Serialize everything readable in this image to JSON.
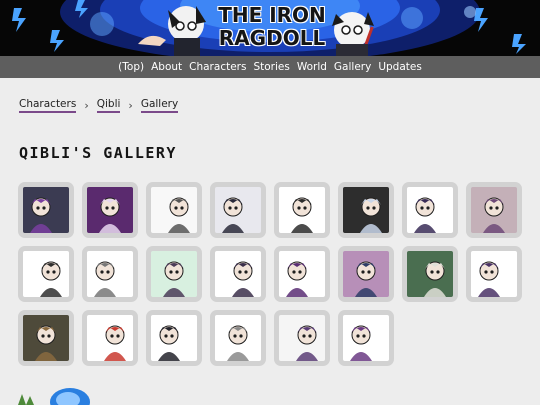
{
  "site": {
    "title_line1": "THE IRON",
    "title_line2": "RAGDOLL"
  },
  "nav": {
    "items": [
      "(Top)",
      "About",
      "Characters",
      "Stories",
      "World",
      "Gallery",
      "Updates"
    ]
  },
  "breadcrumb": {
    "items": [
      "Characters",
      "Qibli",
      "Gallery"
    ]
  },
  "page": {
    "title": "QIBLI'S GALLERY"
  },
  "gallery": {
    "thumbnails": [
      {
        "bg": "#3b3b52",
        "accent": "#7a3fa0"
      },
      {
        "bg": "#5a2a6e",
        "accent": "#e7d7f0"
      },
      {
        "bg": "#f8f8f8",
        "accent": "#555555"
      },
      {
        "bg": "#e8e8ee",
        "accent": "#2a2a3a"
      },
      {
        "bg": "#ffffff",
        "accent": "#2b2b2b"
      },
      {
        "bg": "#2d2d2d",
        "accent": "#c9d6ea"
      },
      {
        "bg": "#ffffff",
        "accent": "#3a2d57"
      },
      {
        "bg": "#c4b0b8",
        "accent": "#6e4a78"
      },
      {
        "bg": "#ffffff",
        "accent": "#2e2e2e"
      },
      {
        "bg": "#ffffff",
        "accent": "#777777"
      },
      {
        "bg": "#d8f0e0",
        "accent": "#4b3b57"
      },
      {
        "bg": "#ffffff",
        "accent": "#3b2f4a"
      },
      {
        "bg": "#ffffff",
        "accent": "#5a2e74"
      },
      {
        "bg": "#b78fb8",
        "accent": "#2e3d66"
      },
      {
        "bg": "#4a6e50",
        "accent": "#e0e0d8"
      },
      {
        "bg": "#ffffff",
        "accent": "#4a3366"
      },
      {
        "bg": "#4e4a3a",
        "accent": "#8a6a3f"
      },
      {
        "bg": "#ffffff",
        "accent": "#c93a2f"
      },
      {
        "bg": "#ffffff",
        "accent": "#23232b"
      },
      {
        "bg": "#ffffff",
        "accent": "#888888"
      },
      {
        "bg": "#f5f5f5",
        "accent": "#5a3d76"
      },
      {
        "bg": "#ffffff",
        "accent": "#6b3b84"
      }
    ]
  },
  "colors": {
    "nav_bg": "#5e5e5e",
    "accent_underline": "#7b4a8a",
    "banner_blue": "#1a4fd0",
    "page_bg": "#ededed"
  }
}
